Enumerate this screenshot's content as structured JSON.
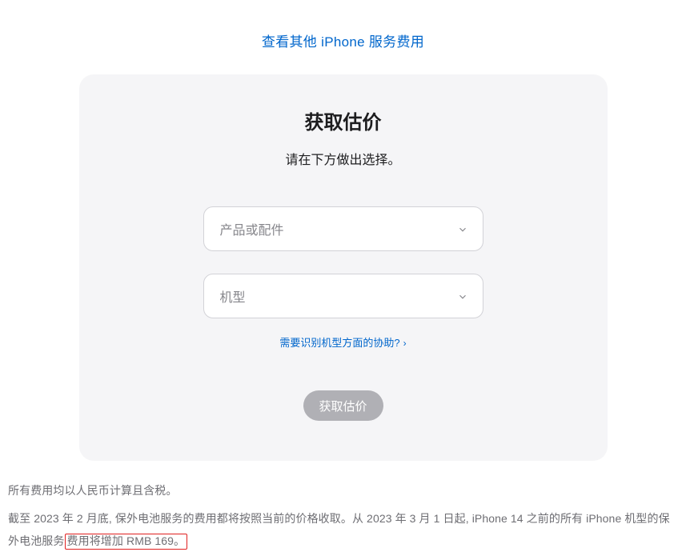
{
  "topLink": {
    "label": "查看其他 iPhone 服务费用"
  },
  "card": {
    "title": "获取估价",
    "subtitle": "请在下方做出选择。",
    "select1": {
      "placeholder": "产品或配件"
    },
    "select2": {
      "placeholder": "机型"
    },
    "helpLink": {
      "label": "需要识别机型方面的协助?"
    },
    "submitBtn": {
      "label": "获取估价"
    }
  },
  "footer": {
    "line1": "所有费用均以人民币计算且含税。",
    "line2a": "截至 2023 年 2 月底, 保外电池服务的费用都将按照当前的价格收取。从 2023 年 3 月 1 日起, iPhone 14 之前的所有 iPhone 机型的保外电池服务",
    "line2b": "费用将增加 RMB 169。"
  }
}
